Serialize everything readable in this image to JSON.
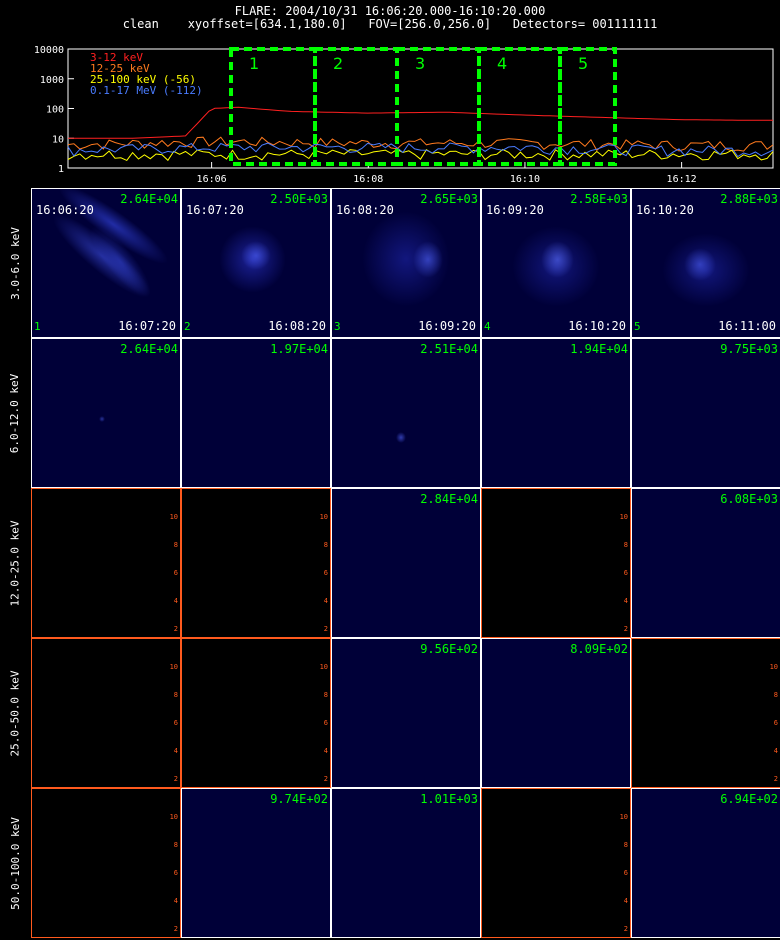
{
  "header": {
    "line1": "FLARE: 2004/10/31 16:06:20.000-16:10:20.000",
    "line2": "clean    xyoffset=[634.1,180.0]   FOV=[256.0,256.0]   Detectors= 001111111"
  },
  "chart_data": [
    {
      "type": "line",
      "yscale": "log",
      "ylim": [
        1,
        10000
      ],
      "yticks": [
        "10000",
        "1000",
        "100",
        "10",
        "1"
      ],
      "xticks": [
        "16:06",
        "16:08",
        "16:10",
        "16:12"
      ],
      "series": [
        {
          "name": "3-12 keV",
          "color": "#ff2020",
          "x": [
            "16:04",
            "16:05",
            "16:05:40",
            "16:06",
            "16:06:20",
            "16:07",
            "16:08",
            "16:09",
            "16:10",
            "16:11",
            "16:12",
            "16:13"
          ],
          "y": [
            10,
            10,
            12,
            100,
            110,
            80,
            70,
            75,
            60,
            50,
            42,
            40
          ]
        },
        {
          "name": "12-25 keV",
          "color": "#ff7a1e",
          "x": [
            "16:04",
            "16:06",
            "16:08",
            "16:10",
            "16:12",
            "16:13"
          ],
          "y": [
            6,
            8,
            7,
            7,
            6,
            6
          ]
        },
        {
          "name": "25-100 keV (-56)",
          "color": "#ffff00",
          "x": [
            "16:04",
            "16:06",
            "16:08",
            "16:10",
            "16:12",
            "16:13"
          ],
          "y": [
            3,
            3,
            3,
            3,
            3,
            3
          ]
        },
        {
          "name": "0.1-17 MeV (-112)",
          "color": "#4a7cff",
          "x": [
            "16:04",
            "16:06",
            "16:08",
            "16:10",
            "16:12",
            "16:13"
          ],
          "y": [
            4,
            5,
            5,
            5,
            4,
            4
          ]
        }
      ],
      "intervals": [
        "1",
        "2",
        "3",
        "4",
        "5"
      ]
    }
  ],
  "rows": [
    {
      "label": "3.0-6.0 keV",
      "cells": [
        {
          "max": "2.64E+04",
          "start": "16:06:20",
          "end": "16:07:20",
          "idx": "1"
        },
        {
          "max": "2.50E+03",
          "start": "16:07:20",
          "end": "16:08:20",
          "idx": "2"
        },
        {
          "max": "2.65E+03",
          "start": "16:08:20",
          "end": "16:09:20",
          "idx": "3"
        },
        {
          "max": "2.58E+03",
          "start": "16:09:20",
          "end": "16:10:20",
          "idx": "4"
        },
        {
          "max": "2.88E+03",
          "start": "16:10:20",
          "end": "16:11:00",
          "idx": "5"
        }
      ]
    },
    {
      "label": "6.0-12.0 keV",
      "cells": [
        {
          "max": "2.64E+04"
        },
        {
          "max": "1.97E+04"
        },
        {
          "max": "2.51E+04"
        },
        {
          "max": "1.94E+04"
        },
        {
          "max": "9.75E+03"
        }
      ]
    },
    {
      "label": "12.0-25.0 keV",
      "cells": [
        {
          "max": ""
        },
        {
          "max": ""
        },
        {
          "max": "2.84E+04"
        },
        {
          "max": ""
        },
        {
          "max": "6.08E+03"
        }
      ]
    },
    {
      "label": "25.0-50.0 keV",
      "cells": [
        {
          "max": ""
        },
        {
          "max": ""
        },
        {
          "max": "9.56E+02"
        },
        {
          "max": "8.09E+02"
        },
        {
          "max": ""
        }
      ]
    },
    {
      "label": "50.0-100.0 keV",
      "cells": [
        {
          "max": ""
        },
        {
          "max": "9.74E+02"
        },
        {
          "max": "1.01E+03"
        },
        {
          "max": ""
        },
        {
          "max": "6.94E+02"
        }
      ]
    }
  ],
  "empty_axis_ticks": [
    "2",
    "4",
    "6",
    "8",
    "10"
  ],
  "colors": {
    "accent": "#00ff00",
    "empty_border": "#ff5a1e",
    "image_bg": "#000038"
  }
}
